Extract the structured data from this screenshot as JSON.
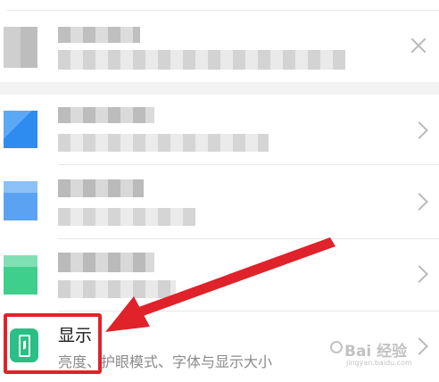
{
  "display_item": {
    "title": "显示",
    "subtitle": "亮度、护眼模式、字体与显示大小"
  },
  "watermark": {
    "brand": "Bai 经验",
    "url": "jingyan.baidu.com"
  },
  "colors": {
    "display_icon": "#2bbf86",
    "highlight_box": "#e0222a",
    "arrow": "#e0222a",
    "chevron": "#b9b9b9",
    "row_icon_blue": "#2e8bf0",
    "row_icon_light_blue": "#5ba3f2",
    "row_icon_green": "#3fcf8c"
  },
  "icons": {
    "display_icon": "display-phone-icon",
    "dismiss": "close-icon",
    "row_chevron": "chevron-right-icon"
  },
  "annotation": {
    "highlighted_item": "显示",
    "arrow_points_to": "显示"
  }
}
